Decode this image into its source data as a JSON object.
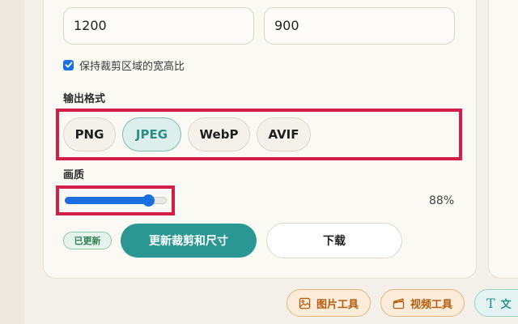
{
  "dimensions": {
    "width_value": "1200",
    "height_value": "900"
  },
  "keep_ratio": {
    "checked": true,
    "label": "保持裁剪区域的宽高比"
  },
  "output_format": {
    "label": "输出格式",
    "options": [
      "PNG",
      "JPEG",
      "WebP",
      "AVIF"
    ],
    "selected": "JPEG"
  },
  "quality": {
    "label": "画质",
    "value": 88,
    "value_text": "88%"
  },
  "actions": {
    "status_badge": "已更新",
    "update_button": "更新裁剪和尺寸",
    "download_button": "下载"
  },
  "tools_nav": {
    "items": [
      {
        "label": "图片工具",
        "icon": "image-icon"
      },
      {
        "label": "视频工具",
        "icon": "clapperboard-icon"
      },
      {
        "label": "文",
        "icon": "text-icon"
      }
    ]
  },
  "colors": {
    "accent_teal": "#2a9792",
    "slider_blue": "#1a6fe0",
    "highlight_red": "#d21e4a",
    "badge_green": "#2e7f55"
  }
}
